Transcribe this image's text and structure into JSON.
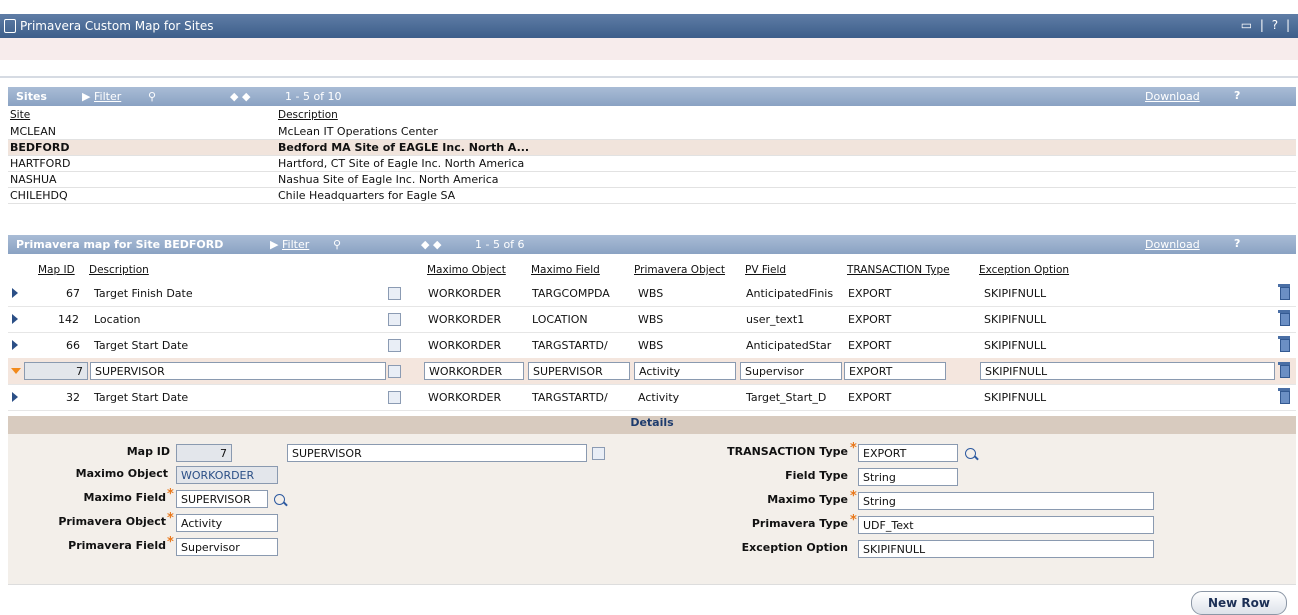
{
  "window": {
    "title": "Primavera Custom Map for Sites",
    "controls": "▭ | ? |"
  },
  "sites": {
    "header": "Sites",
    "filter": "Filter",
    "paging": "1 - 5 of 10",
    "download": "Download",
    "help": "?",
    "columns": {
      "site": "Site",
      "description": "Description"
    },
    "rows": [
      {
        "site": "MCLEAN",
        "description": "McLean IT Operations Center"
      },
      {
        "site": "BEDFORD",
        "description": "Bedford MA Site of EAGLE Inc. North A..."
      },
      {
        "site": "HARTFORD",
        "description": "Hartford, CT Site of Eagle Inc. North America"
      },
      {
        "site": "NASHUA",
        "description": "Nashua Site of Eagle Inc. North America"
      },
      {
        "site": "CHILEHDQ",
        "description": "Chile Headquarters for Eagle SA"
      }
    ]
  },
  "map": {
    "header": "Primavera map for Site BEDFORD",
    "filter": "Filter",
    "paging": "1 - 5 of 6",
    "download": "Download",
    "help": "?",
    "columns": {
      "map_id": "Map ID",
      "description": "Description",
      "maximo_object": "Maximo Object",
      "maximo_field": "Maximo Field",
      "primavera_object": "Primavera Object",
      "pv_field": "PV Field",
      "transaction_type": "TRANSACTION Type",
      "exception_option": "Exception Option"
    },
    "rows": [
      {
        "id": "67",
        "desc": "Target Finish Date",
        "mobj": "WORKORDER",
        "mfield": "TARGCOMPDA",
        "pobj": "WBS",
        "pvfield": "AnticipatedFinis",
        "ttype": "EXPORT",
        "exc": "SKIPIFNULL"
      },
      {
        "id": "142",
        "desc": "Location",
        "mobj": "WORKORDER",
        "mfield": "LOCATION",
        "pobj": "WBS",
        "pvfield": "user_text1",
        "ttype": "EXPORT",
        "exc": "SKIPIFNULL"
      },
      {
        "id": "66",
        "desc": "Target Start Date",
        "mobj": "WORKORDER",
        "mfield": "TARGSTARTD/",
        "pobj": "WBS",
        "pvfield": "AnticipatedStar",
        "ttype": "EXPORT",
        "exc": "SKIPIFNULL"
      },
      {
        "id": "7",
        "desc": "SUPERVISOR",
        "mobj": "WORKORDER",
        "mfield": "SUPERVISOR",
        "pobj": "Activity",
        "pvfield": "Supervisor",
        "ttype": "EXPORT",
        "exc": "SKIPIFNULL"
      },
      {
        "id": "32",
        "desc": "Target Start Date",
        "mobj": "WORKORDER",
        "mfield": "TARGSTARTD/",
        "pobj": "Activity",
        "pvfield": "Target_Start_D",
        "ttype": "EXPORT",
        "exc": "SKIPIFNULL"
      }
    ]
  },
  "details": {
    "header": "Details",
    "map_id_label": "Map ID",
    "map_id": "7",
    "description": "SUPERVISOR",
    "maximo_object_label": "Maximo Object",
    "maximo_object": "WORKORDER",
    "maximo_field_label": "Maximo Field",
    "maximo_field": "SUPERVISOR",
    "primavera_object_label": "Primavera Object",
    "primavera_object": "Activity",
    "primavera_field_label": "Primavera Field",
    "primavera_field": "Supervisor",
    "transaction_type_label": "TRANSACTION Type",
    "transaction_type": "EXPORT",
    "field_type_label": "Field Type",
    "field_type": "String",
    "maximo_type_label": "Maximo Type",
    "maximo_type": "String",
    "primavera_type_label": "Primavera Type",
    "primavera_type": "UDF_Text",
    "exception_option_label": "Exception Option",
    "exception_option": "SKIPIFNULL"
  },
  "new_row_button": "New Row",
  "colors": {
    "title_bar": "#4a6b96",
    "section_header": "#97adcb",
    "selected_row": "#f1e4dc",
    "required": "#e8771a"
  }
}
